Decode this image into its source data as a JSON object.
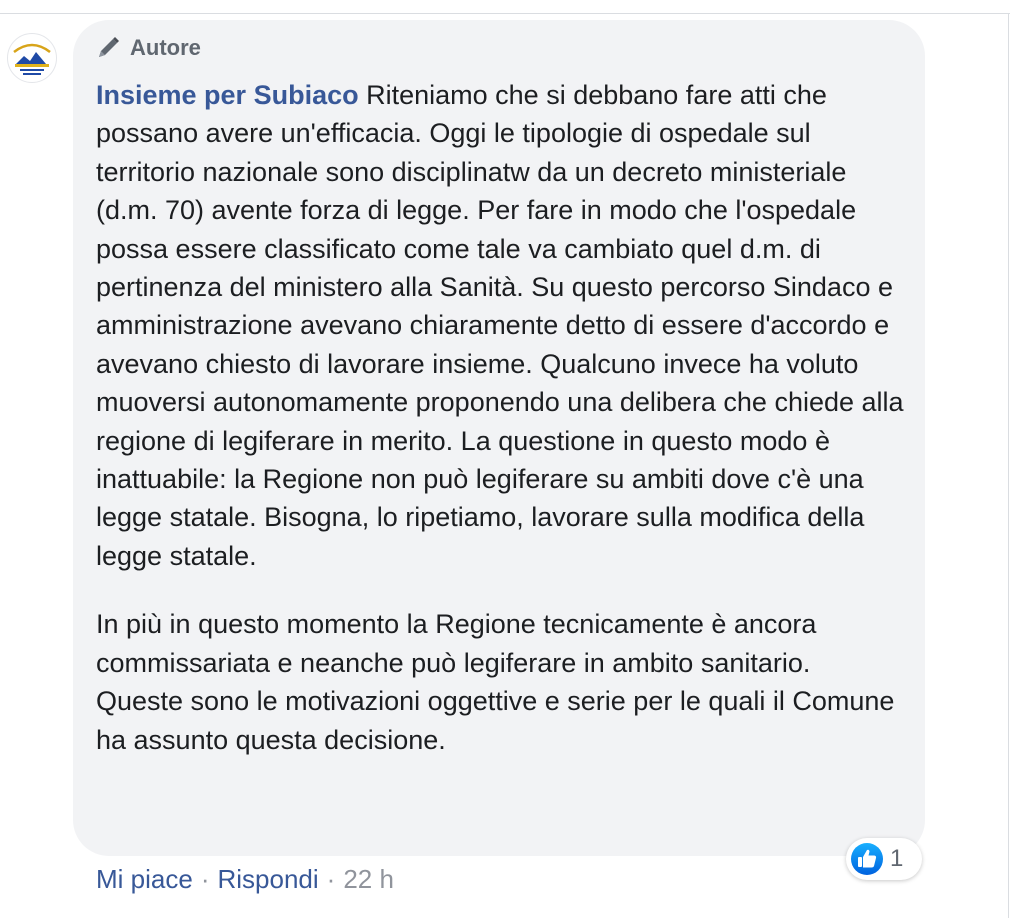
{
  "author_badge": {
    "icon": "pencil-icon",
    "label": "Autore"
  },
  "comment": {
    "author": "Insieme per Subiaco",
    "paragraph1": "Riteniamo che si debbano fare atti che possano avere un'efficacia. Oggi le tipologie di ospedale sul territorio nazionale sono disciplinatw da un decreto ministeriale (d.m. 70) avente forza di legge. Per fare in modo che l'ospedale possa essere classificato come tale va cambiato quel d.m. di pertinenza del ministero alla Sanità. Su questo percorso Sindaco e amministrazione avevano chiaramente detto di essere d'accordo e avevano chiesto di lavorare insieme. Qualcuno invece ha voluto muoversi autonomamente proponendo una delibera che chiede alla regione di legiferare in merito. La questione in questo modo è inattuabile: la Regione non può legiferare su ambiti dove c'è una legge statale. Bisogna, lo ripetiamo, lavorare sulla modifica della legge statale.",
    "paragraph2": "In più in questo momento la Regione tecnicamente è ancora commissariata e neanche può legiferare in ambito sanitario. Queste sono le motivazioni oggettive e serie per le quali il Comune ha assunto questa decisione."
  },
  "reactions": {
    "icon": "like-icon",
    "count": "1",
    "color": "#1877f2"
  },
  "actions": {
    "like_label": "Mi piace",
    "separator": "·",
    "reply_label": "Rispondi",
    "time": "22 h"
  },
  "colors": {
    "link": "#385898",
    "text": "#1c1e21",
    "muted": "#606770",
    "bubble": "#f2f3f5"
  }
}
